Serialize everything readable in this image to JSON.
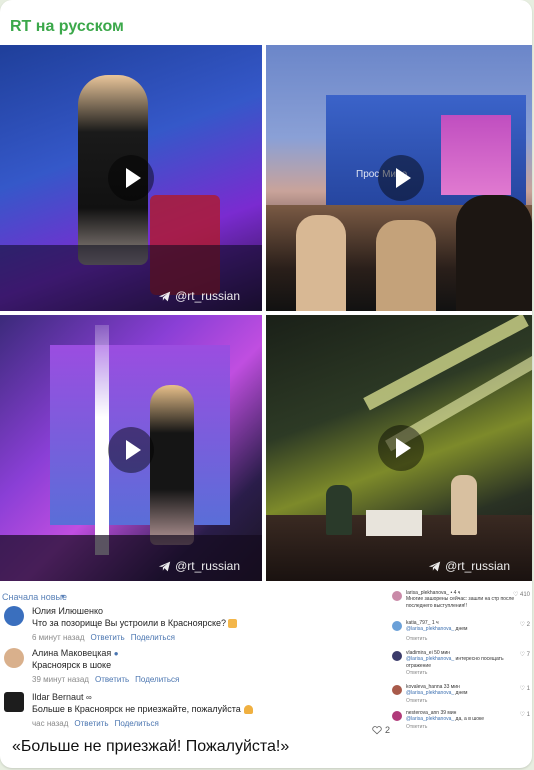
{
  "channel": {
    "name": "RT на русском"
  },
  "media": [
    {
      "kind": "video",
      "watermark": "@rt_russian",
      "overlay_text": ""
    },
    {
      "kind": "video",
      "watermark": "",
      "overlay_text": "Прос            Миро"
    },
    {
      "kind": "video",
      "watermark": "@rt_russian",
      "overlay_text": ""
    },
    {
      "kind": "video",
      "watermark": "@rt_russian",
      "overlay_text": ""
    }
  ],
  "comments": {
    "sort_label": "Сначала новые",
    "items": [
      {
        "name": "Юлия Илюшенко",
        "text": "Что за позорище Вы устроили в Красноярске?",
        "time": "6 минут назад",
        "reply": "Ответить",
        "share": "Поделиться",
        "avatar_color": "#3a6fbe"
      },
      {
        "name": "Алина Маковецкая",
        "text": "Красноярск в шоке",
        "time": "39 минут назад",
        "reply": "Ответить",
        "share": "Поделиться",
        "avatar_color": "#d9b08c"
      },
      {
        "name": "Ildar Bernaut",
        "text": "Больше в Красноярск не приезжайте, пожалуйста",
        "time": "час назад",
        "reply": "Ответить",
        "share": "Поделиться",
        "likes": "2",
        "avatar_color": "#1d1d1d"
      }
    ]
  },
  "side_comments": [
    {
      "name": "larisa_plekhanova_ • 4 ч",
      "text": "Многие зашорены сейчас: зашли на стр после последнего выступления!!",
      "mention": "",
      "reply": "",
      "likes": "♡ 410",
      "avatar_color": "#c98aa8"
    },
    {
      "name": "katia_797_ 1 ч",
      "text": " днем",
      "mention": "@larisa_plekhanova_",
      "reply": "Ответить",
      "likes": "♡ 2",
      "avatar_color": "#6aa0d8"
    },
    {
      "name": "vladimira_ei 50 мин",
      "text": " интересно посещать отражение",
      "mention": "@larisa_plekhanova_",
      "reply": "Ответить",
      "likes": "♡ 7",
      "avatar_color": "#3b3b6a"
    },
    {
      "name": "kovaleva_hanna 33 мин",
      "text": " днем",
      "mention": "@larisa_plekhanova_",
      "reply": "Ответить",
      "likes": "♡ 1",
      "avatar_color": "#a85a4a"
    },
    {
      "name": "nesterova_ann 39 мин",
      "text": " да, а в шоке",
      "mention": "@larisa_plekhanova_",
      "reply": "Ответить",
      "likes": "♡ 1",
      "avatar_color": "#b03a7a"
    }
  ],
  "caption": "«Больше не приезжай! Пожалуйста!»"
}
